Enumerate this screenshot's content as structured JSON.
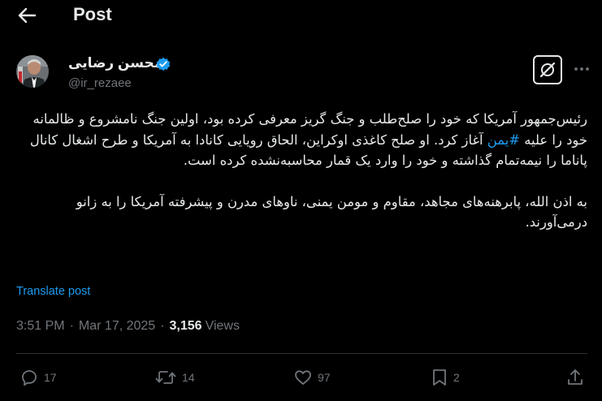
{
  "header": {
    "title": "Post"
  },
  "author": {
    "name": "محسن رضایی",
    "handle": "@ir_rezaee",
    "verified": true
  },
  "tweet": {
    "paragraph1_before_hashtag": "رئیس‌جمهور آمریکا که خود را صلح‌طلب و جنگ گریز معرفی کرده بود، اولین جنگ نامشروع و ظالمانه خود را علیه ",
    "hashtag": "#یمن",
    "paragraph1_after_hashtag": " آغاز کرد. او صلح کاغذی اوکراین، الحاق رویایی کانادا به آمریکا و طرح اشغال کانال پاناما را نیمه‌تمام گذاشته و خود را وارد یک قمار محاسبه‌نشده کرده است.",
    "paragraph2": "به اذن الله، پابرهنه‌های مجاهد، مقاوم و مومن یمنی، ناوهای مدرن و پیشرفته آمریکا را به زانو درمی‌آورند."
  },
  "translate_label": "Translate post",
  "meta": {
    "time": "3:51 PM",
    "separator": "·",
    "date": "Mar 17, 2025",
    "views_count": "3,156",
    "views_label": "Views"
  },
  "actions": {
    "replies": "17",
    "reposts": "14",
    "likes": "97",
    "bookmarks": "2"
  },
  "icons": {
    "back": "arrow-left-icon",
    "verified": "verified-badge-icon",
    "grok": "grok-icon",
    "more": "more-horizontal-icon",
    "reply": "reply-icon",
    "repost": "repost-icon",
    "like": "heart-icon",
    "bookmark": "bookmark-icon",
    "share": "share-icon"
  },
  "colors": {
    "background": "#000000",
    "text_primary": "#e7e9ea",
    "text_secondary": "#71767b",
    "accent": "#1d9bf0"
  }
}
